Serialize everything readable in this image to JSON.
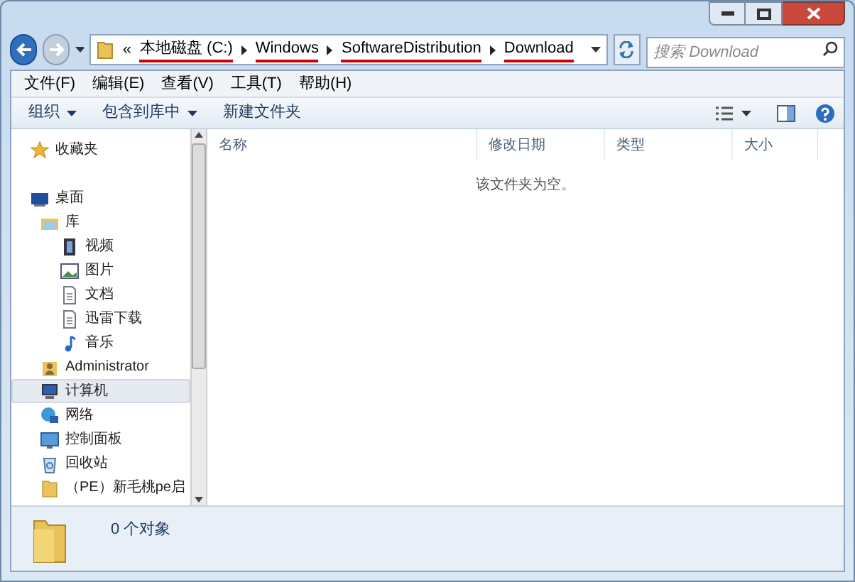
{
  "address_bar": {
    "segments": [
      "本地磁盘 (C:)",
      "Windows",
      "SoftwareDistribution",
      "Download"
    ],
    "overflow": "«"
  },
  "search": {
    "placeholder": "搜索 Download"
  },
  "menu_bar": [
    "文件(F)",
    "编辑(E)",
    "查看(V)",
    "工具(T)",
    "帮助(H)"
  ],
  "toolbar": [
    {
      "label": "组织",
      "dropdown": true
    },
    {
      "label": "包含到库中",
      "dropdown": true
    },
    {
      "label": "新建文件夹",
      "dropdown": false
    }
  ],
  "sidebar": {
    "items": [
      {
        "label": "收藏夹",
        "kind": "star",
        "selected": false
      },
      {
        "label": "桌面",
        "kind": "desktop",
        "selected": false,
        "children": [
          {
            "label": "库",
            "kind": "library",
            "selected": false,
            "children": [
              {
                "label": "视频",
                "kind": "video",
                "selected": false
              },
              {
                "label": "图片",
                "kind": "picture",
                "selected": false
              },
              {
                "label": "文档",
                "kind": "document",
                "selected": false
              },
              {
                "label": "迅雷下载",
                "kind": "document",
                "selected": false
              },
              {
                "label": "音乐",
                "kind": "music",
                "selected": false
              }
            ]
          },
          {
            "label": "Administrator",
            "kind": "user",
            "selected": false
          },
          {
            "label": "计算机",
            "kind": "computer",
            "selected": true
          },
          {
            "label": "网络",
            "kind": "network",
            "selected": false
          },
          {
            "label": "控制面板",
            "kind": "control",
            "selected": false
          },
          {
            "label": "回收站",
            "kind": "bin",
            "selected": false
          },
          {
            "label": "（PE）新毛桃pe启",
            "kind": "folder",
            "selected": false
          }
        ]
      }
    ]
  },
  "table": {
    "columns": [
      "名称",
      "修改日期",
      "类型",
      "大小"
    ],
    "empty_message": "该文件夹为空。"
  },
  "status_bar": {
    "text": "0 个对象"
  }
}
